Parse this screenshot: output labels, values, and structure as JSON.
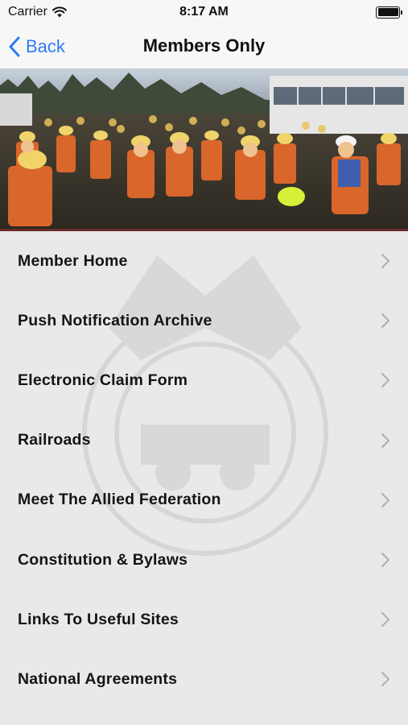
{
  "status_bar": {
    "carrier": "Carrier",
    "time": "8:17 AM"
  },
  "nav": {
    "back_label": "Back",
    "title": "Members Only"
  },
  "menu": {
    "items": [
      {
        "label": "Member Home"
      },
      {
        "label": "Push Notification Archive"
      },
      {
        "label": "Electronic Claim Form"
      },
      {
        "label": "Railroads"
      },
      {
        "label": "Meet The Allied Federation"
      },
      {
        "label": "Constitution & Bylaws"
      },
      {
        "label": "Links To Useful Sites"
      },
      {
        "label": "National Agreements"
      }
    ]
  },
  "colors": {
    "accent": "#2f7cf6",
    "nav_background": "#f7f7f7",
    "list_background": "#e9e9e9",
    "chevron": "#b0b0b0"
  },
  "icons": [
    "wifi-icon",
    "battery-icon",
    "chevron-left-icon",
    "chevron-right-icon"
  ]
}
